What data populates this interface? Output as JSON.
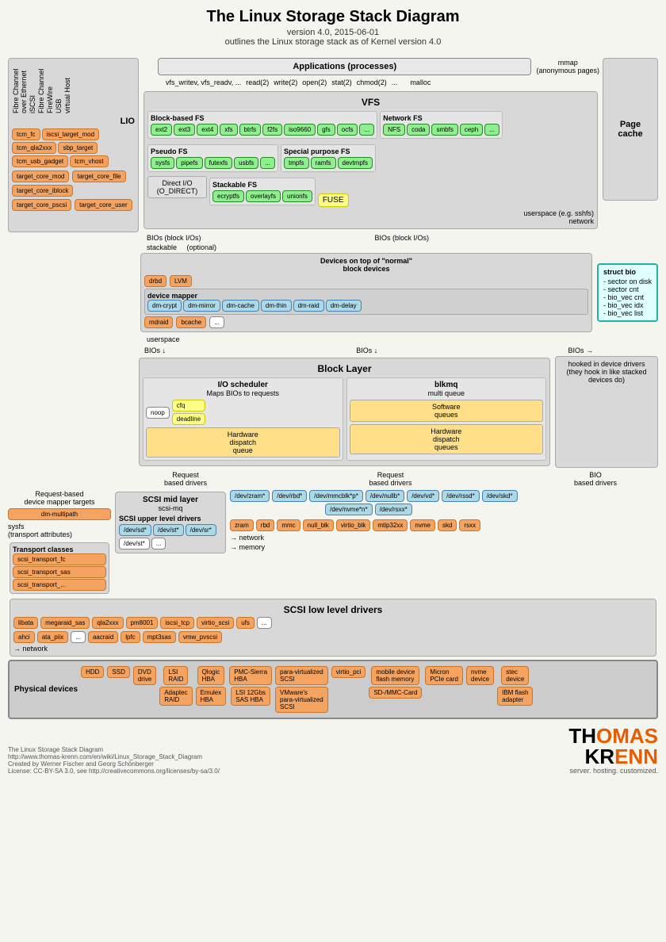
{
  "title": "The Linux Storage Stack Diagram",
  "subtitle_line1": "version 4.0, 2015-06-01",
  "subtitle_line2": "outlines the Linux storage stack as of Kernel version 4.0",
  "lio": {
    "label": "LIO",
    "vertical_labels": [
      "Fibre Channel",
      "over Ethernet",
      "iSCSI",
      "Fibre Channel",
      "FireWire",
      "USB",
      "virtual Host"
    ],
    "modules": [
      "tcm_fc",
      "iscsi_target_mod",
      "tcm_qla2xxx",
      "sbp_target",
      "tcm_usb_gadget",
      "tcm_vhost"
    ],
    "target_core_mod": "target_core_mod",
    "target_core_file": "target_core_file",
    "target_core_iblock": "target_core_iblock",
    "target_core_pscsi": "target_core_pscsi",
    "target_core_user": "target_core_user"
  },
  "applications": "Applications (processes)",
  "vfs_call": "vfs_writev, vfs_readv, ...",
  "syscalls": [
    "read(2)",
    "write(2)",
    "open(2)",
    "stat(2)",
    "chmod(2)",
    "..."
  ],
  "mmap_label": "mmap\n(anonymous pages)",
  "malloc_label": "malloc",
  "vfs_label": "VFS",
  "page_cache_label": "Page\ncache",
  "block_based_fs": {
    "label": "Block-based FS",
    "items": [
      "ext2",
      "ext3",
      "ext4",
      "xfs",
      "btrfs",
      "f2fs",
      "iso9660",
      "gfs",
      "ocfs",
      "..."
    ]
  },
  "network_fs": {
    "label": "Network FS",
    "items": [
      "NFS",
      "coda",
      "smbfs",
      "...",
      "ceph"
    ]
  },
  "pseudo_fs": {
    "label": "Pseudo FS",
    "items": [
      "sysfs",
      "pipefs",
      "futexfs",
      "usbfs",
      "..."
    ]
  },
  "special_fs": {
    "label": "Special purpose FS",
    "items": [
      "tmpfs",
      "ramfs",
      "devtmpfs"
    ]
  },
  "stackable_fs": {
    "label": "Stackable FS",
    "items": [
      "ecryptfs",
      "overlayfs",
      "unionfs"
    ]
  },
  "fuse": "FUSE",
  "userspace_sshfs": "userspace (e.g. sshfs)",
  "network_label": "network",
  "stackable_label": "stackable",
  "optional_label": "(optional)",
  "devices_on_top": "Devices on top of \"normal\"\nblock devices",
  "bios_block_ios_1": "BIOs (block I/Os)",
  "bios_block_ios_2": "BIOs (block I/Os)",
  "device_drivers": [
    "drbd",
    "LVM"
  ],
  "device_mapper": "device mapper",
  "dm_items": [
    "dm-crypt",
    "dm-mirror",
    "dm-cache",
    "dm-thin",
    "dm-raid",
    "dm-delay"
  ],
  "mdraid": "mdraid",
  "bcache": "bcache",
  "struct_bio": {
    "label": "struct bio",
    "items": [
      "- sector on disk",
      "- sector cnt",
      "- bio_vec cnt",
      "- bio_vec idx",
      "- bio_vec list"
    ]
  },
  "userspace_label": "userspace",
  "block_layer": {
    "label": "Block Layer",
    "io_scheduler": {
      "label": "I/O scheduler",
      "sublabel": "Maps BIOs to requests",
      "items": [
        "noop",
        "cfq",
        "deadline"
      ],
      "hw_queue": "Hardware\ndispatch\nqueue"
    },
    "blkmq": {
      "label": "blkmq",
      "sublabel": "multi queue",
      "sw_queues": "Software\nqueues",
      "hw_queues": "Hardware\ndispatch\nqueues"
    }
  },
  "bios_down_1": "BIOs",
  "bios_down_2": "BIOs",
  "bios_right": "BIOs",
  "request_based_1": "Request\nbased drivers",
  "request_based_2": "Request\nbased drivers",
  "bio_based_drivers": "BIO\nbased drivers",
  "hooked_label": "hooked in device drivers\n(they hook in like stacked\ndevices do)",
  "req_based_device_mapper": "Request-based\ndevice mapper targets",
  "dm_multipath": "dm-multipath",
  "sysfs_label": "sysfs\n(transport attributes)",
  "transport_classes": {
    "label": "Transport classes",
    "items": [
      "scsi_transport_fc",
      "scsi_transport_sas",
      "scsi_transport_..."
    ]
  },
  "scsi_mid_layer": {
    "label": "SCSI mid layer",
    "sublabel": "scsi-mq",
    "upper_label": "SCSI upper level drivers",
    "upper_items": [
      "/dev/sd*",
      "/dev/st*",
      "/dev/sr*",
      "/dev/st*",
      "..."
    ]
  },
  "block_devices": [
    "/dev/zram*",
    "/dev/rbd*",
    "/dev/mmcblk*p*",
    "/dev/nullb*",
    "/dev/vd*",
    "/dev/rssd*",
    "/dev/skd*",
    "/dev/nvme*n*",
    "/dev/rsxx*"
  ],
  "drivers_row": [
    "zram",
    "rbd",
    "mmc",
    "null_blk",
    "virtio_blk",
    "mtip32xx",
    "nvme",
    "skd",
    "rsxx"
  ],
  "network_arrow": "network",
  "memory_arrow": "memory",
  "scsi_low_level": {
    "label": "SCSI low level drivers",
    "items": [
      "libata",
      "megaraid_sas",
      "qla2xxx",
      "pm8001",
      "iscsi_tcp",
      "virtio_scsi",
      "ufs",
      "..."
    ],
    "items2": [
      "ahci",
      "ata_piix",
      "...",
      "aacraid",
      "lpfc",
      "mpt3sas",
      "vmw_pvscsi"
    ]
  },
  "physical_devices": {
    "label": "Physical devices",
    "items": [
      "HDD",
      "SSD",
      "DVD\ndrive",
      "LSI\nRAID",
      "Qlogic\nHBA",
      "PMC-Sierra\nHBA",
      "LSI 12Gbs\nSAS HBA",
      "para-virtualized\nSCSI",
      "virtio_pci",
      "mobile device\nflash memory",
      "Micron\nPCIe card",
      "nvme\ndevice",
      "stec\ndevice"
    ],
    "items2": [
      "Adaptec\nRAID",
      "Emulex\nHBA"
    ],
    "items3": [
      "VMware's\npara-virtualized\nSCSI"
    ],
    "items4": [
      "SD-/MMC-Card"
    ],
    "items5": [
      "IBM flash\nadapter"
    ]
  },
  "footer": {
    "line1": "The Linux Storage Stack Diagram",
    "line2": "http://www.thomas-krenn.com/en/wiki/Linux_Storage_Stack_Diagram",
    "line3": "Created by Werner Fischer and Georg Schönberger",
    "line4": "License: CC-BY-SA 3.0, see http://creativecommons.org/licenses/by-sa/3.0/",
    "logo_th": "TH",
    "logo_omas": "OMAS",
    "logo_kr": "KR",
    "logo_enn": "ENN",
    "logo_tagline": "server. hosting. customized."
  }
}
